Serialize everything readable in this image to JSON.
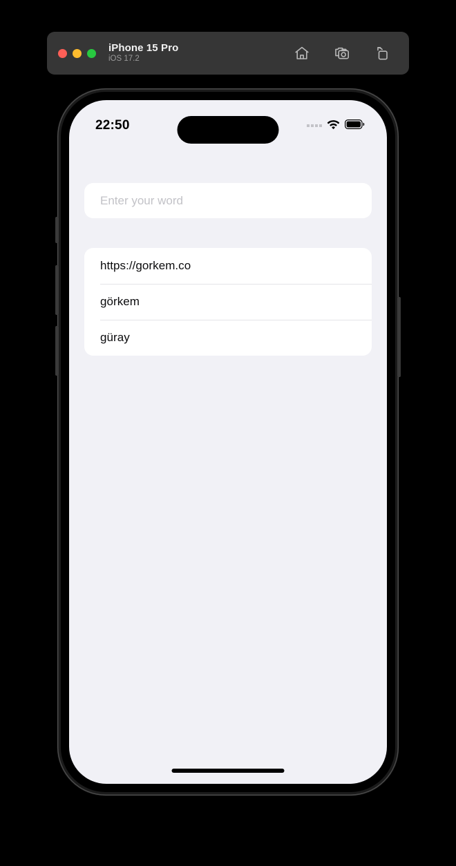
{
  "simulator_window": {
    "device_name": "iPhone 15 Pro",
    "os_version": "iOS 17.2",
    "traffic_lights": [
      {
        "name": "close",
        "color": "#ff5f57"
      },
      {
        "name": "minimize",
        "color": "#febc2e"
      },
      {
        "name": "maximize",
        "color": "#28c840"
      }
    ],
    "actions": [
      {
        "icon": "home-icon",
        "label": "Home"
      },
      {
        "icon": "screenshot-icon",
        "label": "Screenshot"
      },
      {
        "icon": "rotate-icon",
        "label": "Rotate"
      }
    ],
    "titlebar_color": "#363636"
  },
  "status_bar": {
    "time": "22:50",
    "cellular_icon": "cellular-dots-icon",
    "wifi_icon": "wifi-icon",
    "battery_icon": "battery-full-icon"
  },
  "app": {
    "search": {
      "placeholder": "Enter your word",
      "value": ""
    },
    "results": [
      {
        "text": "https://gorkem.co"
      },
      {
        "text": "görkem"
      },
      {
        "text": "güray"
      }
    ]
  },
  "theme": {
    "screen_background": "#f1f1f6",
    "card_background": "#ffffff",
    "text_color": "#0b0b0d",
    "placeholder_color": "#c2c2c7",
    "separator_color": "#e4e4e8"
  }
}
